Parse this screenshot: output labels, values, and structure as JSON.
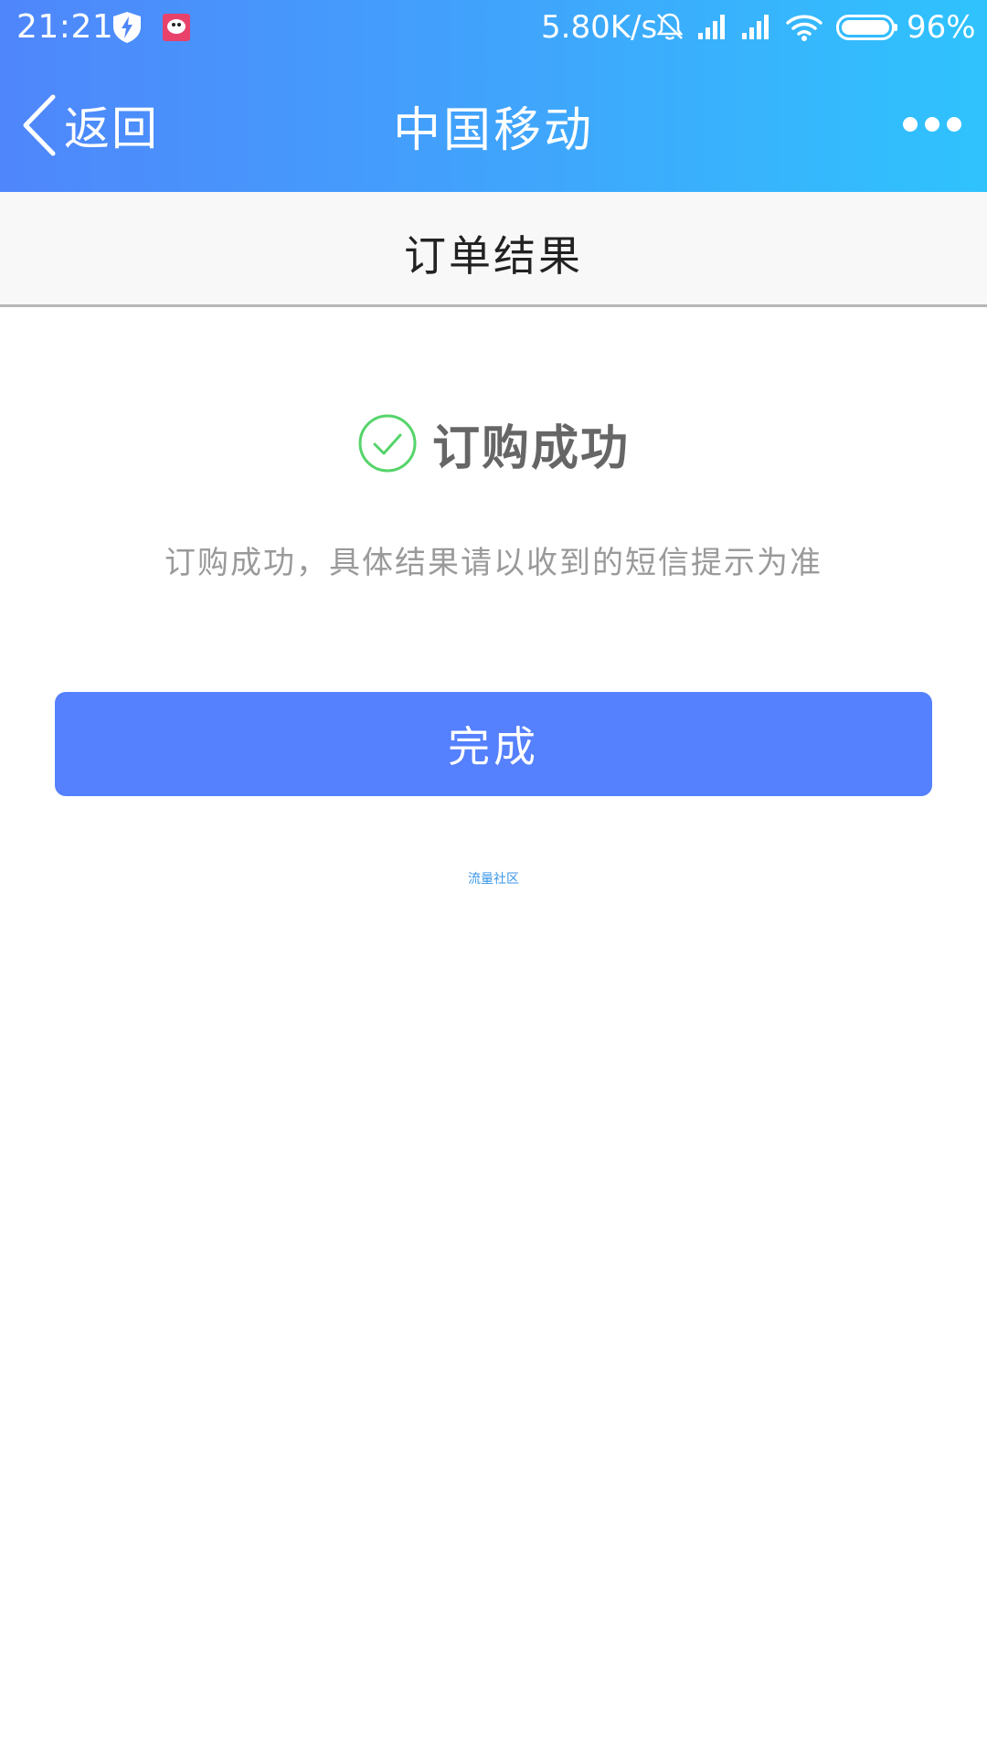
{
  "status_bar": {
    "time": "21:21",
    "net_speed": "5.80K/s",
    "battery_percent": "96%",
    "icons": [
      "shield-icon",
      "app-notification-icon",
      "bell-muted-icon",
      "signal-icon",
      "signal-icon",
      "wifi-icon",
      "battery-icon"
    ]
  },
  "app_bar": {
    "back_label": "返回",
    "title": "中国移动",
    "more_icon": "more-dots-icon"
  },
  "section": {
    "title": "订单结果"
  },
  "result": {
    "icon": "check-circle-icon",
    "title": "订购成功",
    "description": "订购成功，具体结果请以收到的短信提示为准"
  },
  "actions": {
    "done_label": "完成"
  },
  "footer": {
    "link_text": "流量社区"
  },
  "colors": {
    "header_gradient_start": "#4f86fb",
    "header_gradient_end": "#2fc3fd",
    "primary_button": "#5580fe",
    "success_green": "#55d46a",
    "footer_link": "#3a96e8"
  }
}
